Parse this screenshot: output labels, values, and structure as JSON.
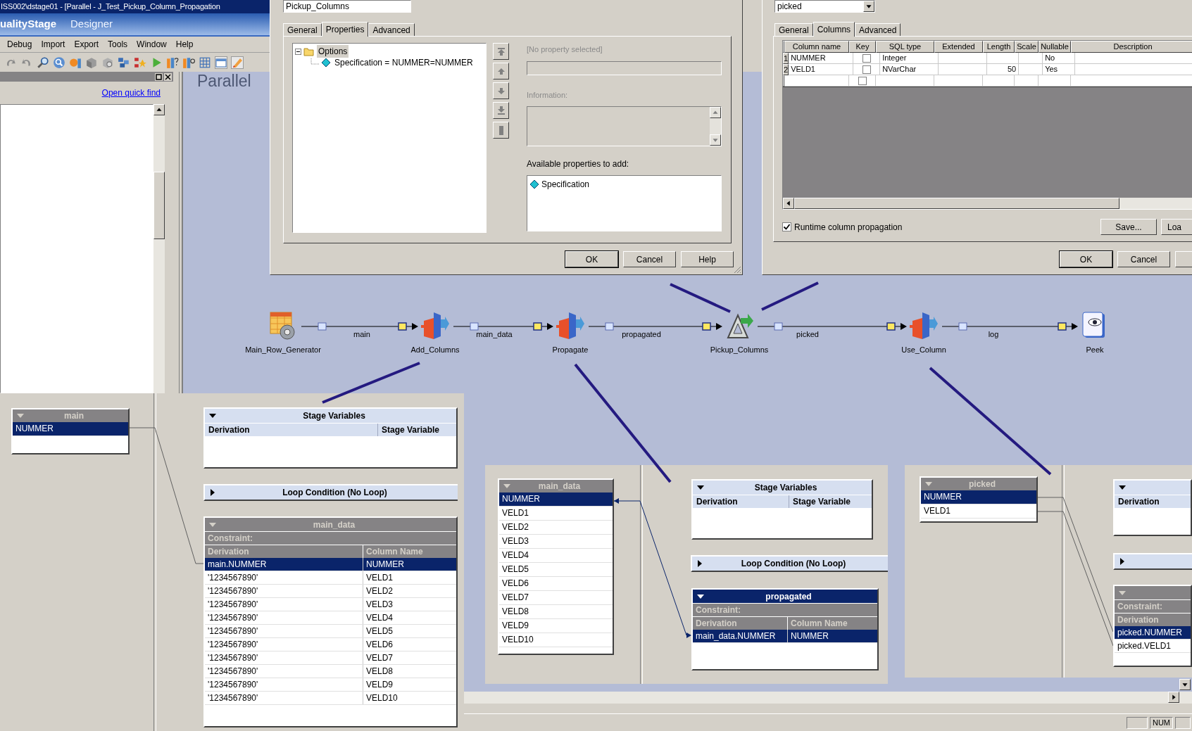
{
  "window": {
    "title": "ISS002\\dstage01 - [Parallel - J_Test_Pickup_Column_Propagation"
  },
  "app_header": {
    "product": "ualityStage",
    "module": "Designer"
  },
  "menu": [
    "Debug",
    "Import",
    "Export",
    "Tools",
    "Window",
    "Help"
  ],
  "repository": {
    "link": "Open quick find"
  },
  "canvas": {
    "label": "Parallel"
  },
  "stage_dialog": {
    "stage_name": "Pickup_Columns",
    "tabs": [
      {
        "label": "General",
        "selected": false
      },
      {
        "label": "Properties",
        "selected": true
      },
      {
        "label": "Advanced",
        "selected": false
      }
    ],
    "tree": [
      {
        "label": "Options",
        "expanded": true,
        "selected": true,
        "children": [
          {
            "label": "Specification = NUMMER=NUMMER",
            "selected": false
          }
        ]
      }
    ],
    "property_prompt": "[No property selected]",
    "information_label": "Information:",
    "available_label": "Available properties to add:",
    "available": [
      "Specification"
    ],
    "buttons": [
      "OK",
      "Cancel",
      "Help"
    ]
  },
  "output_dialog": {
    "link": "picked",
    "tabs": [
      {
        "label": "General",
        "selected": false
      },
      {
        "label": "Columns",
        "selected": true
      },
      {
        "label": "Advanced",
        "selected": false
      }
    ],
    "columns": [
      "Column name",
      "Key",
      "SQL type",
      "Extended",
      "Length",
      "Scale",
      "Nullable",
      "Description"
    ],
    "rows": [
      {
        "number": "1",
        "name": "NUMMER",
        "key": false,
        "sql_type": "Integer",
        "nullable": "No"
      },
      {
        "number": "2",
        "name": "VELD1",
        "key": false,
        "sql_type": "NVarChar",
        "length": "50",
        "nullable": "Yes"
      },
      {
        "key": false
      }
    ],
    "runtime_propagation": {
      "label": "Runtime column propagation",
      "checked": true
    },
    "grid_buttons": [
      "Save...",
      "Loa"
    ],
    "buttons": [
      "OK",
      "Cancel"
    ]
  },
  "job": {
    "stages": [
      {
        "name": "Main_Row_Generator",
        "kind": "generator"
      },
      {
        "name": "Add_Columns",
        "kind": "transformer"
      },
      {
        "name": "Propagate",
        "kind": "transformer"
      },
      {
        "name": "Pickup_Columns",
        "kind": "column_import"
      },
      {
        "name": "Use_Column",
        "kind": "transformer"
      },
      {
        "name": "Peek",
        "kind": "peek"
      }
    ],
    "links": [
      {
        "label": "main"
      },
      {
        "label": "main_data"
      },
      {
        "label": "propagated"
      },
      {
        "label": "picked"
      },
      {
        "label": "log"
      }
    ]
  },
  "transformer_views": [
    {
      "input": {
        "title": "main",
        "rows": [
          {
            "name": "NUMMER",
            "selected": true
          }
        ]
      },
      "stage_variables": {
        "title": "Stage Variables",
        "expanded": true,
        "columns": [
          "Derivation",
          "Stage Variable"
        ]
      },
      "loop": {
        "title": "Loop Condition (No Loop)",
        "expanded": false
      },
      "output": {
        "title": "main_data",
        "active": false,
        "constraint": "Constraint:",
        "columns": [
          "Derivation",
          "Column Name"
        ],
        "rows": [
          {
            "derivation": "main.NUMMER",
            "column": "NUMMER",
            "selected": true
          },
          {
            "derivation": "'1234567890'",
            "column": "VELD1",
            "selected": false
          },
          {
            "derivation": "'1234567890'",
            "column": "VELD2",
            "selected": false
          },
          {
            "derivation": "'1234567890'",
            "column": "VELD3",
            "selected": false
          },
          {
            "derivation": "'1234567890'",
            "column": "VELD4",
            "selected": false
          },
          {
            "derivation": "'1234567890'",
            "column": "VELD5",
            "selected": false
          },
          {
            "derivation": "'1234567890'",
            "column": "VELD6",
            "selected": false
          },
          {
            "derivation": "'1234567890'",
            "column": "VELD7",
            "selected": false
          },
          {
            "derivation": "'1234567890'",
            "column": "VELD8",
            "selected": false
          },
          {
            "derivation": "'1234567890'",
            "column": "VELD9",
            "selected": false
          },
          {
            "derivation": "'1234567890'",
            "column": "VELD10",
            "selected": false
          }
        ]
      }
    },
    {
      "input": {
        "title": "main_data",
        "rows": [
          {
            "name": "NUMMER",
            "selected": true
          },
          {
            "name": "VELD1",
            "selected": false
          },
          {
            "name": "VELD2",
            "selected": false
          },
          {
            "name": "VELD3",
            "selected": false
          },
          {
            "name": "VELD4",
            "selected": false
          },
          {
            "name": "VELD5",
            "selected": false
          },
          {
            "name": "VELD6",
            "selected": false
          },
          {
            "name": "VELD7",
            "selected": false
          },
          {
            "name": "VELD8",
            "selected": false
          },
          {
            "name": "VELD9",
            "selected": false
          },
          {
            "name": "VELD10",
            "selected": false
          }
        ]
      },
      "stage_variables": {
        "title": "Stage Variables",
        "expanded": true,
        "columns": [
          "Derivation",
          "Stage Variable"
        ]
      },
      "loop": {
        "title": "Loop Condition (No Loop)",
        "expanded": false
      },
      "output": {
        "title": "propagated",
        "active": true,
        "constraint": "Constraint:",
        "columns": [
          "Derivation",
          "Column Name"
        ],
        "rows": [
          {
            "derivation": "main_data.NUMMER",
            "column": "NUMMER",
            "selected": true
          }
        ]
      }
    },
    {
      "input": {
        "title": "picked",
        "rows": [
          {
            "name": "NUMMER",
            "selected": true
          },
          {
            "name": "VELD1",
            "selected": false
          }
        ]
      },
      "stage_variables": {
        "expanded": true,
        "columns": [
          "Derivation"
        ]
      },
      "loop": {
        "expanded": false
      },
      "output": {
        "active": false,
        "constraint": "Constraint:",
        "columns": [
          "Derivation"
        ],
        "rows": [
          {
            "derivation": "picked.NUMMER",
            "selected": true
          },
          {
            "derivation": "picked.VELD1",
            "selected": false
          }
        ]
      }
    }
  ],
  "status_bar": {
    "indicators": [
      "NUM"
    ]
  }
}
